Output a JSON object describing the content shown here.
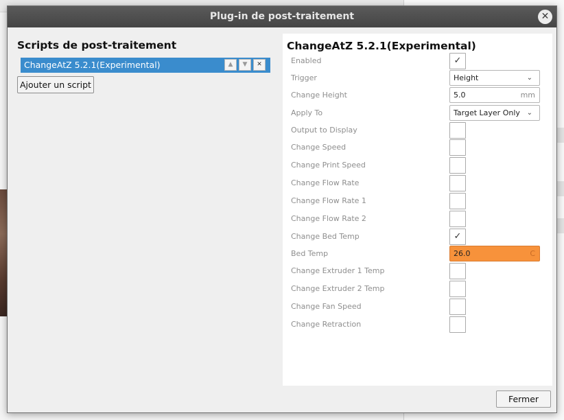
{
  "dialog": {
    "title": "Plug-in de post-traitement",
    "close_glyph": "✕",
    "close_button_label": "Fermer"
  },
  "left": {
    "title": "Scripts de post-traitement",
    "scripts": [
      {
        "label": "ChangeAtZ 5.2.1(Experimental)"
      }
    ],
    "item_buttons": {
      "up": "▲",
      "down": "▼",
      "remove": "✕"
    },
    "add_script_label": "Ajouter un script"
  },
  "right": {
    "title": "ChangeAtZ 5.2.1(Experimental)",
    "settings": {
      "enabled": {
        "label": "Enabled",
        "checked": true
      },
      "trigger": {
        "label": "Trigger",
        "value": "Height"
      },
      "change_height": {
        "label": "Change Height",
        "value": "5.0",
        "unit": "mm"
      },
      "apply_to": {
        "label": "Apply To",
        "value": "Target Layer Only"
      },
      "output_to_display": {
        "label": "Output to Display",
        "checked": false
      },
      "change_speed": {
        "label": "Change Speed",
        "checked": false
      },
      "change_print_speed": {
        "label": "Change Print Speed",
        "checked": false
      },
      "change_flow_rate": {
        "label": "Change Flow Rate",
        "checked": false
      },
      "change_flow_rate_1": {
        "label": "Change Flow Rate 1",
        "checked": false
      },
      "change_flow_rate_2": {
        "label": "Change Flow Rate 2",
        "checked": false
      },
      "change_bed_temp": {
        "label": "Change Bed Temp",
        "checked": true
      },
      "bed_temp": {
        "label": "Bed Temp",
        "value": "26.0",
        "unit": "C",
        "warning_color": "#f7923b"
      },
      "change_extruder_1_temp": {
        "label": "Change Extruder 1 Temp",
        "checked": false
      },
      "change_extruder_2_temp": {
        "label": "Change Extruder 2 Temp",
        "checked": false
      },
      "change_fan_speed": {
        "label": "Change Fan Speed",
        "checked": false
      },
      "change_retraction": {
        "label": "Change Retraction",
        "checked": false
      }
    },
    "check_glyph": "✓",
    "dropdown_glyph": "⌄"
  },
  "colors": {
    "selection": "#3a8ccd",
    "titlebar": "#4d4d4d"
  }
}
